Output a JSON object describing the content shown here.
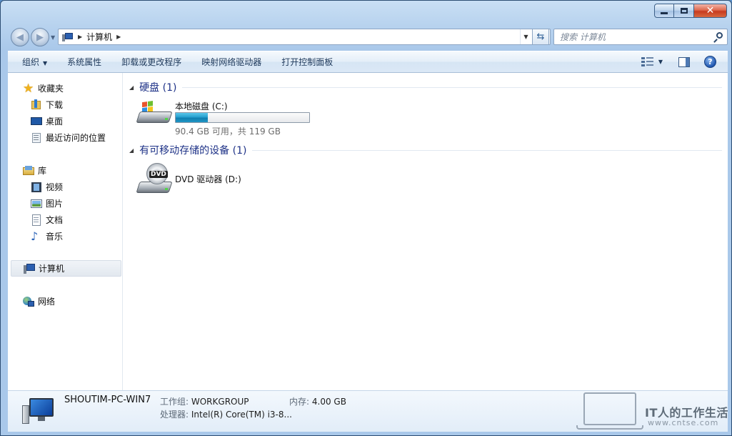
{
  "address_bar": {
    "breadcrumb": [
      "计算机"
    ]
  },
  "search": {
    "placeholder": "搜索 计算机"
  },
  "toolbar": {
    "organize": "组织",
    "system_properties": "系统属性",
    "uninstall": "卸载或更改程序",
    "map_drive": "映射网络驱动器",
    "control_panel": "打开控制面板"
  },
  "sidebar": {
    "favorites": {
      "label": "收藏夹",
      "items": [
        "下载",
        "桌面",
        "最近访问的位置"
      ]
    },
    "libraries": {
      "label": "库",
      "items": [
        "视频",
        "图片",
        "文档",
        "音乐"
      ]
    },
    "computer": "计算机",
    "network": "网络"
  },
  "main": {
    "hard_disks": {
      "header": "硬盘 (1)",
      "drives": [
        {
          "name": "本地磁盘 (C:)",
          "free_text": "90.4 GB 可用，共 119 GB",
          "used_fraction": 0.24
        }
      ]
    },
    "removable": {
      "header": "有可移动存储的设备 (1)",
      "drives": [
        {
          "name": "DVD 驱动器 (D:)",
          "icon_label": "DVD"
        }
      ]
    }
  },
  "details": {
    "pc_name": "SHOUTIM-PC-WIN7",
    "workgroup_label": "工作组:",
    "workgroup_value": "WORKGROUP",
    "memory_label": "内存:",
    "memory_value": "4.00 GB",
    "processor_label": "处理器:",
    "processor_value": "Intel(R) Core(TM) i3-8..."
  },
  "watermark": {
    "title": "IT人的工作生活",
    "url": "www.cntse.com"
  },
  "colors": {
    "capacity_fill": "#27a0cf",
    "group_header": "#1e3287",
    "close_button": "#c73a1f"
  },
  "icons": {
    "title_buttons": [
      "minimize-icon",
      "maximize-icon",
      "close-icon"
    ],
    "nav": [
      "back-arrow-icon",
      "forward-arrow-icon",
      "refresh-icon",
      "search-icon"
    ]
  }
}
